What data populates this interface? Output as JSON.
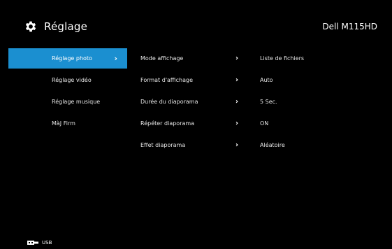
{
  "header": {
    "title": "Réglage",
    "device": "Dell M115HD",
    "icon": "gear-icon"
  },
  "sidebar": {
    "items": [
      {
        "label": "Réglage photo",
        "selected": true
      },
      {
        "label": "Réglage vidéo",
        "selected": false
      },
      {
        "label": "Réglage musique",
        "selected": false
      },
      {
        "label": "MàJ Firm",
        "selected": false
      }
    ]
  },
  "settings": {
    "rows": [
      {
        "label": "Mode affichage",
        "value": "Liste de fichiers"
      },
      {
        "label": "Format d'affichage",
        "value": "Auto"
      },
      {
        "label": "Durée du diaporama",
        "value": "5 Sec."
      },
      {
        "label": "Répéter diaporama",
        "value": "ON"
      },
      {
        "label": "Effet diaporama",
        "value": "Aléatoire"
      }
    ]
  },
  "footer": {
    "source_label": "USB",
    "icon": "usb-icon"
  },
  "colors": {
    "background": "#000000",
    "accent": "#1b8fd0",
    "text": "#ffffff"
  }
}
